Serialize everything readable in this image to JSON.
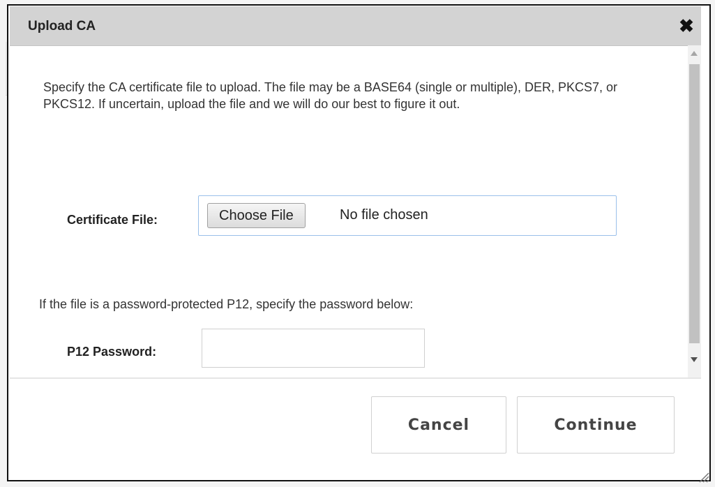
{
  "dialog": {
    "title": "Upload CA",
    "close_icon": "close-icon",
    "description": "Specify the CA certificate file to upload. The file may be a BASE64 (single or multiple), DER, PKCS7, or PKCS12. If uncertain, upload the file and we will do our best to figure it out.",
    "certificate_file": {
      "label": "Certificate File:",
      "button_label": "Choose File",
      "status": "No file chosen"
    },
    "p12_note": "If the file is a password-protected P12, specify the password below:",
    "p12_password": {
      "label": "P12 Password:",
      "value": ""
    },
    "buttons": {
      "cancel": "Cancel",
      "continue": "Continue"
    }
  },
  "colors": {
    "header_bg": "#d3d3d3",
    "file_box_border": "#9ac0ea",
    "background_accent_orange": "#f39c12",
    "background_accent_blue": "#2d8bd9"
  }
}
